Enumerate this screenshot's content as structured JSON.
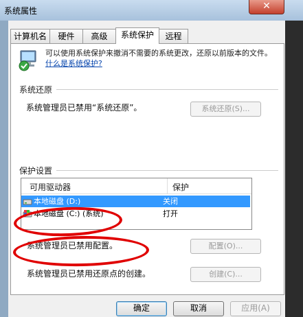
{
  "window": {
    "title": "系统属性",
    "close_glyph": "✕"
  },
  "tabs": [
    {
      "label": "计算机名"
    },
    {
      "label": "硬件"
    },
    {
      "label": "高级"
    },
    {
      "label": "系统保护"
    },
    {
      "label": "远程"
    }
  ],
  "intro": {
    "text": "可以使用系统保护来撤消不需要的系统更改，还原以前版本的文件。",
    "link": "什么是系统保护?"
  },
  "restore": {
    "group_label": "系统还原",
    "status": "系统管理员已禁用“系统还原”。",
    "button": "系统还原(S)..."
  },
  "protection": {
    "group_label": "保护设置",
    "columns": [
      "可用驱动器",
      "保护"
    ],
    "rows": [
      {
        "drive": "本地磁盘 (D:)",
        "state": "关闭",
        "selected": true
      },
      {
        "drive": "本地磁盘 (C:) (系统)",
        "state": "打开",
        "selected": false
      }
    ],
    "config_text": "系统管理员已禁用配置。",
    "config_button": "配置(O)...",
    "create_text": "系统管理员已禁用还原点的创建。",
    "create_button": "创建(C)..."
  },
  "footer": {
    "ok": "确定",
    "cancel": "取消",
    "apply": "应用(A)"
  },
  "colors": {
    "accent": "#3399ff",
    "annotation": "#e00000"
  }
}
